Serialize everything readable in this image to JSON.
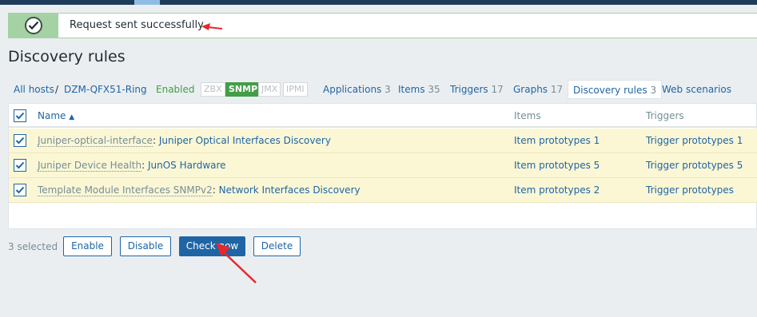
{
  "message": {
    "text": "Request sent successfully"
  },
  "page": {
    "title": "Discovery rules"
  },
  "nav": {
    "all_hosts": "All hosts",
    "separator": "/",
    "host": "DZM-QFX51-Ring",
    "status": "Enabled",
    "availability": [
      "ZBX",
      "SNMP",
      "JMX",
      "IPMI"
    ],
    "availability_active": "SNMP",
    "tabs": [
      {
        "label": "Applications",
        "count": "3"
      },
      {
        "label": "Items",
        "count": "35"
      },
      {
        "label": "Triggers",
        "count": "17"
      },
      {
        "label": "Graphs",
        "count": "17"
      },
      {
        "label": "Discovery rules",
        "count": "3"
      },
      {
        "label": "Web scenarios",
        "count": ""
      }
    ]
  },
  "table": {
    "headers": {
      "name": "Name",
      "name_sort_indicator": "▲",
      "items": "Items",
      "triggers": "Triggers"
    },
    "rows": [
      {
        "template": "Juniper-optical-interface",
        "rule": "Juniper Optical Interfaces Discovery",
        "items": "Item prototypes 1",
        "triggers": "Trigger prototypes 1"
      },
      {
        "template": "Juniper Device Health",
        "rule": "JunOS Hardware",
        "items": "Item prototypes 5",
        "triggers": "Trigger prototypes 5"
      },
      {
        "template": "Template Module Interfaces SNMPv2",
        "rule": "Network Interfaces Discovery",
        "items": "Item prototypes 2",
        "triggers": "Trigger prototypes"
      }
    ],
    "colon": ":"
  },
  "actions": {
    "selected": "3 selected",
    "enable": "Enable",
    "disable": "Disable",
    "check_now": "Check now",
    "delete": "Delete"
  },
  "colors": {
    "accent": "#1f65a6",
    "success": "#429e47",
    "selected_row": "#fbf7d4",
    "annotation_arrow": "#e8282b"
  }
}
